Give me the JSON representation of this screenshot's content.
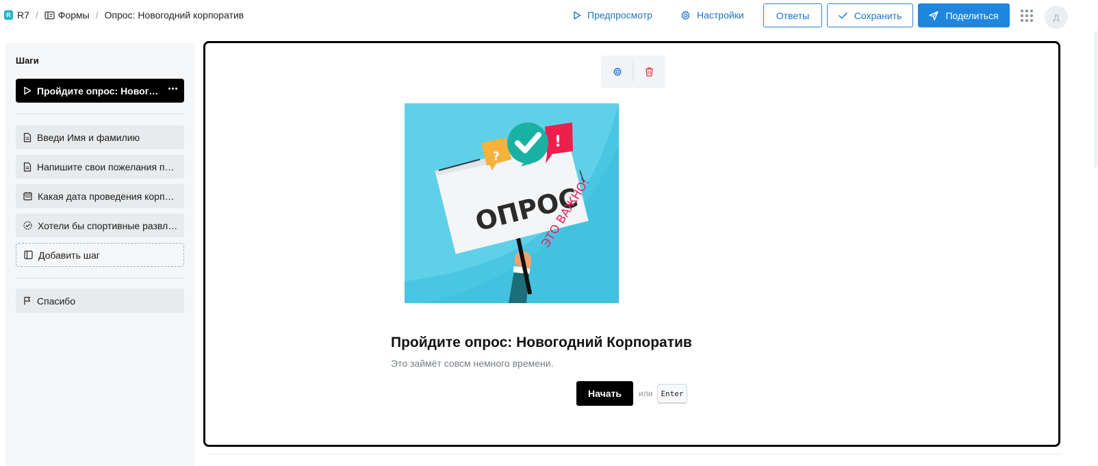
{
  "breadcrumb": {
    "workspace_badge": "R",
    "workspace": "R7",
    "section": "Формы",
    "current": "Опрос: Новогодний корпоратив"
  },
  "topbar": {
    "preview_label": "Предпросмотр",
    "settings_label": "Настройки",
    "answers_label": "Ответы",
    "save_label": "Сохранить",
    "share_label": "Поделиться",
    "avatar_initial": "Д",
    "accent_color": "#1f86df"
  },
  "sidebar": {
    "title": "Шаги",
    "welcome_step": {
      "label": "Пройдите опрос: Новогодний Корпоратив",
      "icon": "play-icon"
    },
    "steps": [
      {
        "label": "Введи Имя и фамилию",
        "icon": "document-icon"
      },
      {
        "label": "Напишите свои пожелания по корпоративу",
        "icon": "document-icon"
      },
      {
        "label": "Какая дата проведения корпоратива",
        "icon": "calendar-icon"
      },
      {
        "label": "Хотели бы спортивные развлечения",
        "icon": "check-circle-icon"
      }
    ],
    "add_step_label": "Добавить шаг",
    "ending_step": {
      "label": "Спасибо",
      "icon": "flag-icon"
    }
  },
  "canvas": {
    "image": {
      "headline": "ОПРОС",
      "tagline": "ЭТО ВАЖНО!",
      "bubble_question": "?",
      "bubble_exclaim": "!"
    },
    "title": "Пройдите опрос: Новогодний Корпоратив",
    "subtitle": "Это займёт совсм немного времени.",
    "start_label": "Начать",
    "or_label": "или",
    "key_hint": "Enter"
  }
}
